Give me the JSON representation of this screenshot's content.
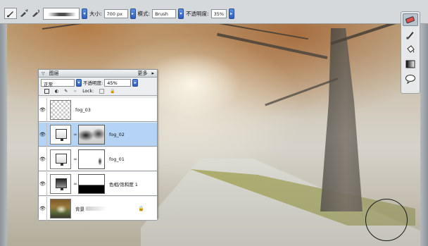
{
  "options_bar": {
    "size_label": "大小:",
    "size_value": "700 px",
    "mode_label": "模式:",
    "mode_value": "Brush",
    "opacity_label": "不透明度:",
    "opacity_value": "35%"
  },
  "toolbox": {
    "tools": [
      "eraser-icon",
      "brush-icon",
      "paint-bucket-icon",
      "gradient-icon",
      "speech-bubble-icon"
    ]
  },
  "layers_panel": {
    "title": "图层",
    "more_label": "更多",
    "blend_mode": "正常",
    "opacity_label": "不透明度:",
    "opacity_value": "45%",
    "lock_label": "Lock:",
    "layers": [
      {
        "name": "fog_03",
        "selected": false
      },
      {
        "name": "fog_02",
        "selected": true
      },
      {
        "name": "fog_01",
        "selected": false
      },
      {
        "name": "色相/饱和度 1",
        "selected": false
      },
      {
        "name": "背景",
        "selected": false
      }
    ]
  },
  "colors": {
    "selection": "#b5d3f5",
    "accent": "#3a6fd0"
  }
}
